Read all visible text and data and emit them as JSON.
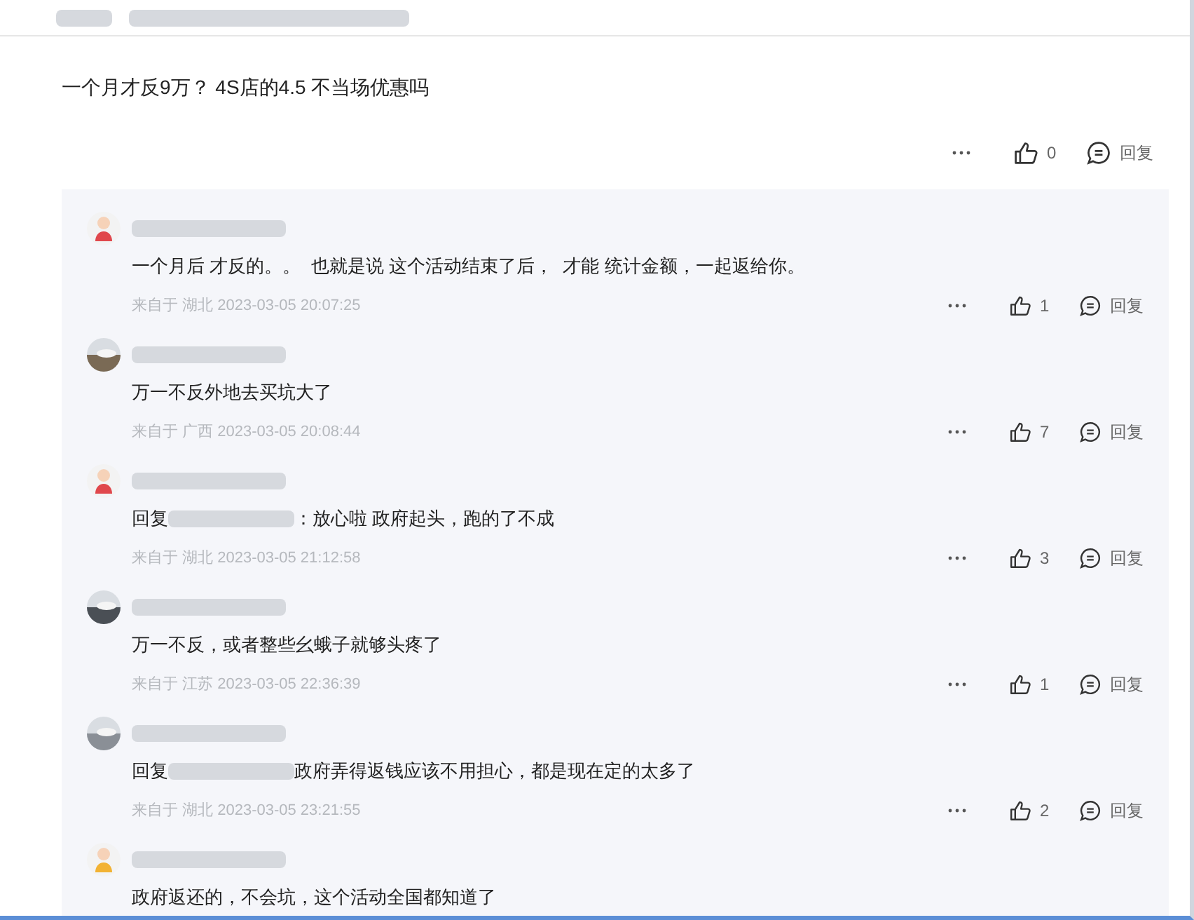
{
  "post": {
    "text": "一个月才反9万？ 4S店的4.5 不当场优惠吗",
    "likes": "0",
    "reply_label": "回复"
  },
  "comments": [
    {
      "avatar": {
        "kind": "cartoon"
      },
      "color": "#e0474c",
      "kind": "plain",
      "text": "一个月后 才反的。。  也就是说 这个活动结束了后，  才能 统计金额，一起返给你。",
      "meta": "来自于 湖北 2023-03-05 20:07:25",
      "likes": "1",
      "reply_label": "回复"
    },
    {
      "avatar": {
        "kind": "photo"
      },
      "color": "#7a6a55",
      "kind": "plain",
      "text": "万一不反外地去买坑大了",
      "meta": "来自于 广西 2023-03-05 20:08:44",
      "likes": "7",
      "reply_label": "回复"
    },
    {
      "avatar": {
        "kind": "cartoon"
      },
      "color": "#e0474c",
      "kind": "reply",
      "prefix": "回复",
      "text": "：放心啦 政府起头，跑的了不成",
      "meta": "来自于 湖北 2023-03-05 21:12:58",
      "likes": "3",
      "reply_label": "回复"
    },
    {
      "avatar": {
        "kind": "photo"
      },
      "color": "#4a4f55",
      "kind": "plain",
      "text": "万一不反，或者整些幺蛾子就够头疼了",
      "meta": "来自于 江苏 2023-03-05 22:36:39",
      "likes": "1",
      "reply_label": "回复"
    },
    {
      "avatar": {
        "kind": "photo"
      },
      "color": "#8a8f96",
      "kind": "reply",
      "prefix": "回复",
      "text": "政府弄得返钱应该不用担心，都是现在定的太多了",
      "meta": "来自于 湖北 2023-03-05 23:21:55",
      "likes": "2",
      "reply_label": "回复"
    },
    {
      "avatar": {
        "kind": "cartoon"
      },
      "color": "#f2b233",
      "kind": "plain",
      "text": "政府返还的，不会坑，这个活动全国都知道了"
    }
  ]
}
